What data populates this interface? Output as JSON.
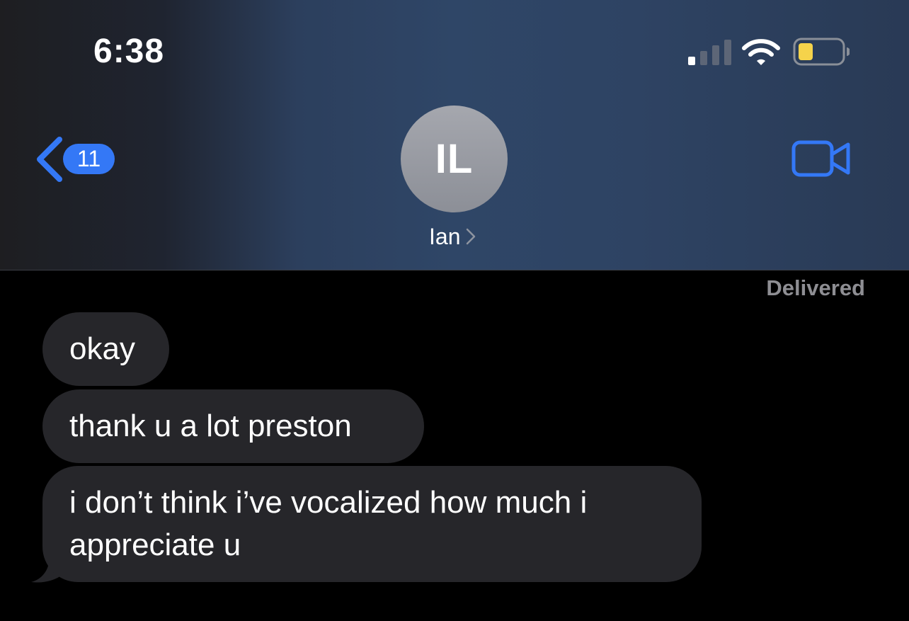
{
  "status_bar": {
    "time": "6:38",
    "signal_icon": "cellular-signal-icon",
    "wifi_icon": "wifi-icon",
    "battery_icon": "battery-low-icon",
    "battery_color": "#f5d34b"
  },
  "nav": {
    "back_icon": "chevron-left-icon",
    "back_badge_count": "11",
    "accent_color": "#3478f6",
    "avatar_initials": "IL",
    "contact_name": "Ian",
    "contact_chevron_icon": "chevron-right-icon",
    "video_call_icon": "video-camera-icon"
  },
  "conversation": {
    "delivered_label": "Delivered",
    "messages": [
      {
        "text": "okay",
        "direction": "incoming"
      },
      {
        "text": "thank u a lot preston",
        "direction": "incoming"
      },
      {
        "lines": [
          "i don’t think i’ve vocalized how much i",
          "appreciate u"
        ],
        "direction": "incoming"
      }
    ]
  }
}
